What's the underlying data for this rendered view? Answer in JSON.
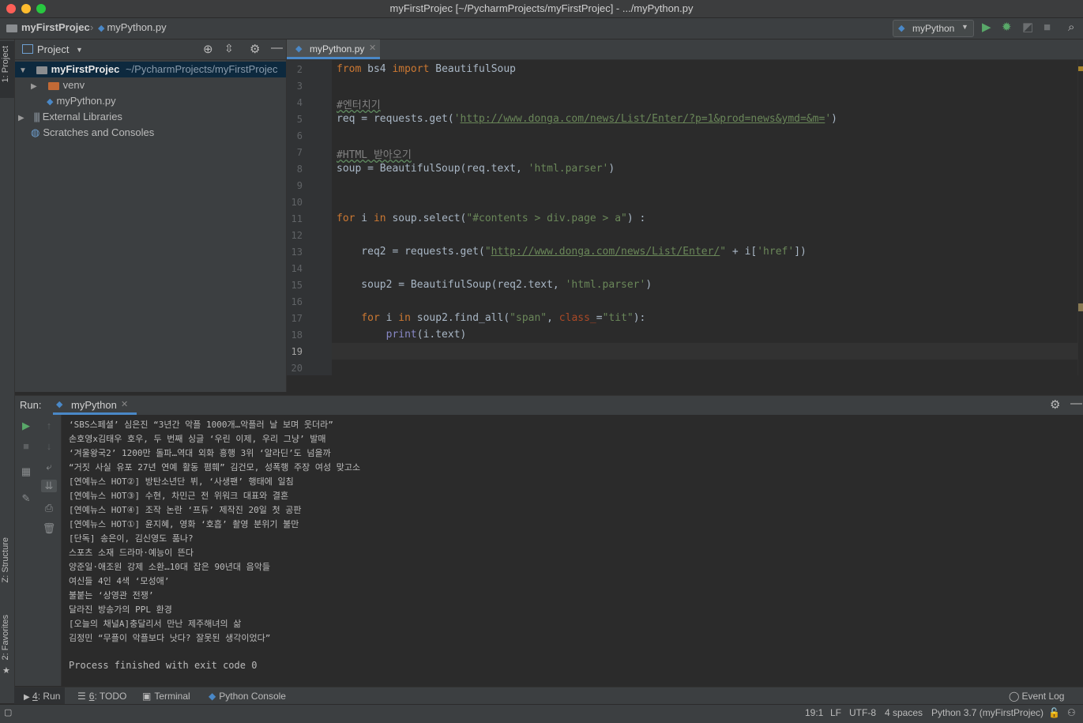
{
  "window": {
    "title": "myFirstProjec [~/PycharmProjects/myFirstProjec] - .../myPython.py"
  },
  "navbar": {
    "project": "myFirstProjec",
    "file": "myPython.py",
    "run_config": "myPython"
  },
  "left_stripe": {
    "project_tab": "1: Project",
    "structure_tab": "Z: Structure",
    "favorites_tab": "2: Favorites"
  },
  "project_panel": {
    "header": "Project",
    "tree": [
      {
        "label": "myFirstProjec",
        "path": "~/PycharmProjects/myFirstProjec"
      },
      {
        "label": "venv"
      },
      {
        "label": "myPython.py"
      },
      {
        "label": "External Libraries"
      },
      {
        "label": "Scratches and Consoles"
      }
    ]
  },
  "editor": {
    "tab": "myPython.py",
    "line_numbers": [
      "2",
      "3",
      "4",
      "5",
      "6",
      "7",
      "8",
      "9",
      "10",
      "11",
      "12",
      "13",
      "14",
      "15",
      "16",
      "17",
      "18",
      "19",
      "20"
    ],
    "code": {
      "l2_kw1": "from",
      "l2_mid": " bs4 ",
      "l2_kw2": "import",
      "l2_end": " BeautifulSoup",
      "l4_comment": "#엔터치기",
      "l5_pre": "req = requests.get(",
      "l5_q1": "'",
      "l5_url": "http://www.donga.com/news/List/Enter/?p=1&prod=news&ymd=&m=",
      "l5_q2": "'",
      "l5_post": ")",
      "l7_comment": "#HTML 받아오기",
      "l8_pre": "soup = BeautifulSoup(req.text, ",
      "l8_str": "'html.parser'",
      "l8_post": ")",
      "l11_kw1": "for",
      "l11_a": " i ",
      "l11_kw2": "in",
      "l11_b": " soup.select(",
      "l11_str": "\"#contents > div.page > a\"",
      "l11_c": ") :",
      "l13_pre": "    req2 = requests.get(",
      "l13_q1": "\"",
      "l13_url": "http://www.donga.com/news/List/Enter/",
      "l13_q2": "\"",
      "l13_mid": " + i[",
      "l13_str": "'href'",
      "l13_post": "])",
      "l15_pre": "    soup2 = BeautifulSoup(req2.text, ",
      "l15_str": "'html.parser'",
      "l15_post": ")",
      "l17_kw1": "    for",
      "l17_a": " i ",
      "l17_kw2": "in",
      "l17_b": " soup2.find_all(",
      "l17_str1": "\"span\"",
      "l17_c": ", ",
      "l17_param": "class_",
      "l17_d": "=",
      "l17_str2": "\"tit\"",
      "l17_e": "):",
      "l18_fn": "        print",
      "l18_rest": "(i.text)"
    }
  },
  "run_panel": {
    "label": "Run:",
    "tab": "myPython",
    "output": [
      "‘SBS스페셜’ 심은진 “3년간 악플 1000개…악플러 날 보며 웃더라”",
      "손호영x김태우 호우, 두 번째 싱글 ‘우린 이제, 우리 그냥’ 발매",
      "‘겨울왕국2’ 1200만 돌파…역대 외화 흥행 3위 ‘알라딘’도 넘을까",
      "“거짓 사실 유포 27년 연예 활동 폄훼” 김건모, 성폭행 주장 여성 맞고소",
      "[연예뉴스 HOT②] 방탄소년단 뷔, ‘사생팬’ 행태에 일침",
      "[연예뉴스 HOT③] 수현, 차민근 전 위워크 대표와 결혼",
      "[연예뉴스 HOT④] 조작 논란 ‘프듀’ 제작진 20일 첫 공판",
      "[연예뉴스 HOT①] 윤지혜, 영화 ‘호흡’ 촬영 분위기 불만",
      "[단독] 송은이, 김신영도 품나?",
      "스포츠 소재 드라마·예능이 뜬다",
      "양준일·애조원 강제 소환…10대 잡은 90년대 음악들",
      "여신들 4인 4색 ‘모성애’",
      "불붙는 ‘상영관 전쟁’",
      "달라진 방송가의 PPL 환경",
      "[오늘의 채널A]충달리서 만난 제주해녀의 삶",
      "김정민 “무플이 악플보다 낫다? 잘못된 생각이었다”"
    ],
    "process_finished": "Process finished with exit code 0"
  },
  "tool_tabs": {
    "run": {
      "num": "4",
      "label": ": Run"
    },
    "todo": {
      "num": "6",
      "label": ": TODO"
    },
    "terminal": "Terminal",
    "python_console": "Python Console",
    "event_log": "Event Log"
  },
  "status_bar": {
    "position": "19:1",
    "line_sep": "LF",
    "encoding": "UTF-8",
    "indent": "4 spaces",
    "interpreter": "Python 3.7 (myFirstProjec)"
  },
  "colors": {
    "accent": "#4a88c7",
    "run_green": "#59a869",
    "keyword": "#cc7832",
    "string": "#6a8759"
  },
  "icons": [
    "folder-icon",
    "python-file-icon",
    "play-icon",
    "debug-icon",
    "coverage-icon",
    "stop-icon",
    "search-icon",
    "gear-icon",
    "locate-icon",
    "collapse-icon",
    "hide-icon",
    "rerun-icon",
    "up-arrow-icon",
    "down-arrow-icon",
    "soft-wrap-icon",
    "scroll-to-end-icon",
    "print-icon",
    "trash-icon",
    "pin-icon",
    "layout-icon",
    "event-log-icon",
    "lock-icon"
  ]
}
